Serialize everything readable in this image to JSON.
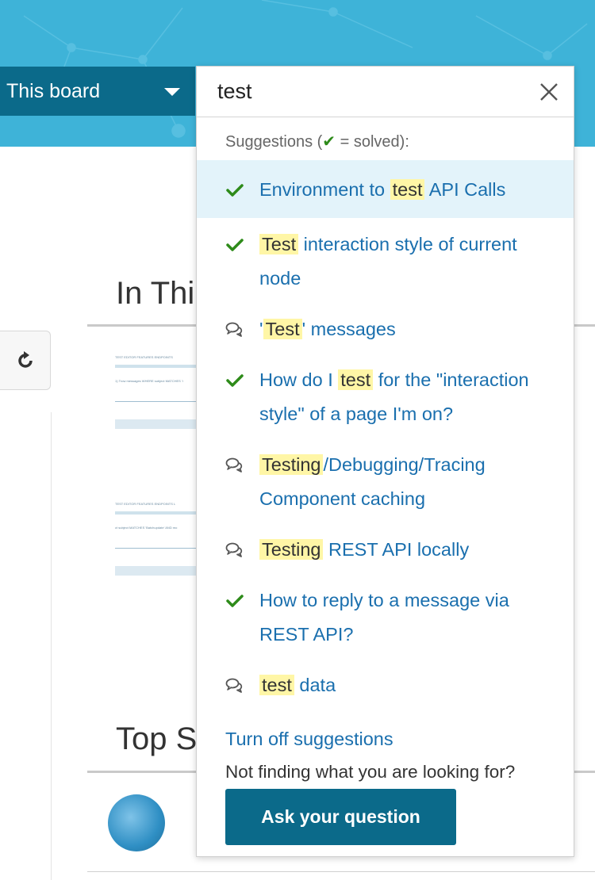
{
  "scope_selector": {
    "label": "This board",
    "icon": "chevron-down-icon"
  },
  "search": {
    "value": "test",
    "clear_icon": "close-icon"
  },
  "suggestions": {
    "header_prefix": "Suggestions (",
    "header_check": "✔",
    "header_suffix": " = solved):",
    "items": [
      {
        "type": "solved",
        "icon": "check-icon",
        "before": "Environment to ",
        "highlight": "test",
        "after": " API Calls",
        "active": true
      },
      {
        "type": "solved",
        "icon": "check-icon",
        "before": "",
        "highlight": "Test",
        "after": " interaction style of current node",
        "active": false
      },
      {
        "type": "discussion",
        "icon": "speech-bubbles-icon",
        "before": "'",
        "highlight": "Test",
        "after": "' messages",
        "active": false
      },
      {
        "type": "solved",
        "icon": "check-icon",
        "before": "How do I ",
        "highlight": "test",
        "after": " for the \"interaction style\" of a page I'm on?",
        "active": false
      },
      {
        "type": "discussion",
        "icon": "speech-bubbles-icon",
        "before": "",
        "highlight": "Testing",
        "after": "/Debugging/Tracing Component caching",
        "active": false
      },
      {
        "type": "discussion",
        "icon": "speech-bubbles-icon",
        "before": "",
        "highlight": "Testing",
        "after": " REST API locally",
        "active": false
      },
      {
        "type": "solved",
        "icon": "check-icon",
        "before": "How to reply to a message via REST API?",
        "highlight": "",
        "after": "",
        "active": false
      },
      {
        "type": "discussion",
        "icon": "speech-bubbles-icon",
        "before": "",
        "highlight": "test",
        "after": " data",
        "active": false
      }
    ],
    "turn_off_label": "Turn off suggestions",
    "not_finding_text": "Not finding what you are looking for?",
    "ask_button_label": "Ask your question"
  },
  "background": {
    "section_title_1": "In Thi",
    "section_title_2": "Top S",
    "reset_icon": "refresh-icon",
    "thumb_header_1": "TEST EDITOR   FEATURES   ENDPOINTS",
    "thumb_text_1": "1) Trow messages WHERE subject MATCHES 'i",
    "thumb_header_2": "TEST EDITOR   FEATURES   ENDPOINTS   L",
    "thumb_text_2": "ct subject MATCHES 'Batchupdate' AND mo"
  },
  "colors": {
    "brand": "#0b6a8a",
    "hero": "#3eb3d8",
    "link": "#1a6fae",
    "solved_check": "#2e8b1a",
    "highlight": "#fff6a6",
    "active_row": "#e3f3fa"
  }
}
